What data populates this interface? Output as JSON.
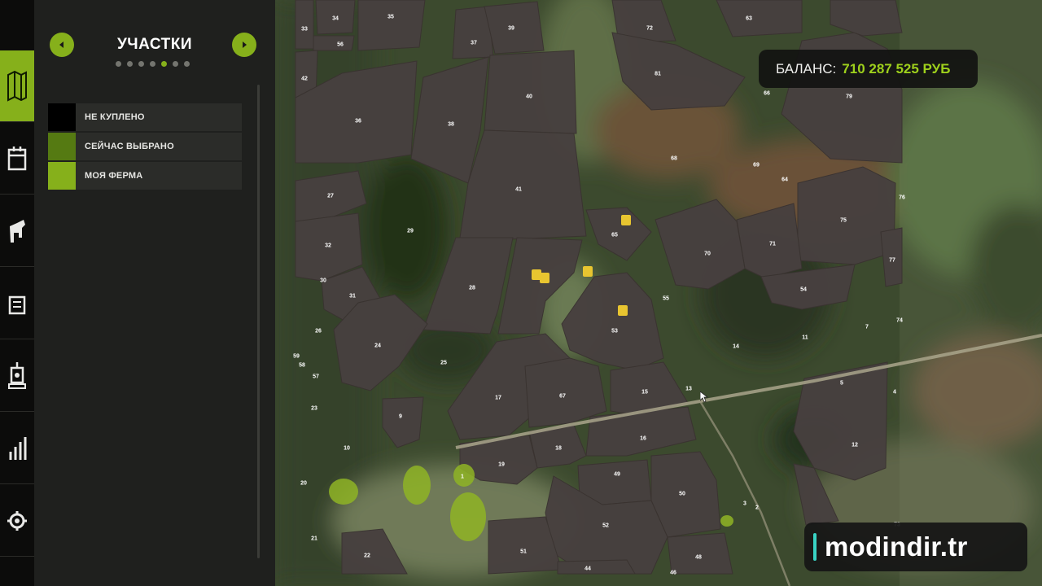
{
  "panel": {
    "title": "УЧАСТКИ",
    "page_count": 7,
    "active_page": 5
  },
  "legend": [
    {
      "label": "НЕ КУПЛЕНО",
      "color": "#000000"
    },
    {
      "label": "СЕЙЧАС ВЫБРАНО",
      "color": "#557a12"
    },
    {
      "label": "МОЯ ФЕРМА",
      "color": "#86b01b"
    }
  ],
  "balance": {
    "label": "БАЛАНС:",
    "value": "710 287 525 РУБ"
  },
  "watermark": "modindir.tr",
  "rail": [
    "map-icon",
    "calendar-icon",
    "animals-icon",
    "contracts-icon",
    "production-icon",
    "statistics-icon",
    "settings-icon"
  ],
  "colors": {
    "accent": "#86b01b",
    "field_unowned": "#47403f",
    "balance_value": "#9ed01c"
  },
  "field_numbers": [
    "33",
    "34",
    "35",
    "37",
    "39",
    "72",
    "63",
    "56",
    "42",
    "81",
    "40",
    "36",
    "38",
    "66",
    "79",
    "68",
    "69",
    "64",
    "41",
    "76",
    "27",
    "29",
    "65",
    "75",
    "32",
    "71",
    "77",
    "70",
    "30",
    "54",
    "28",
    "31",
    "55",
    "7",
    "74",
    "53",
    "26",
    "24",
    "14",
    "11",
    "25",
    "59",
    "58",
    "57",
    "17",
    "67",
    "15",
    "13",
    "5",
    "4",
    "23",
    "9",
    "16",
    "18",
    "12",
    "10",
    "19",
    "49",
    "20",
    "50",
    "1",
    "3",
    "2",
    "52",
    "21",
    "51",
    "22",
    "48",
    "44",
    "46",
    "73"
  ]
}
